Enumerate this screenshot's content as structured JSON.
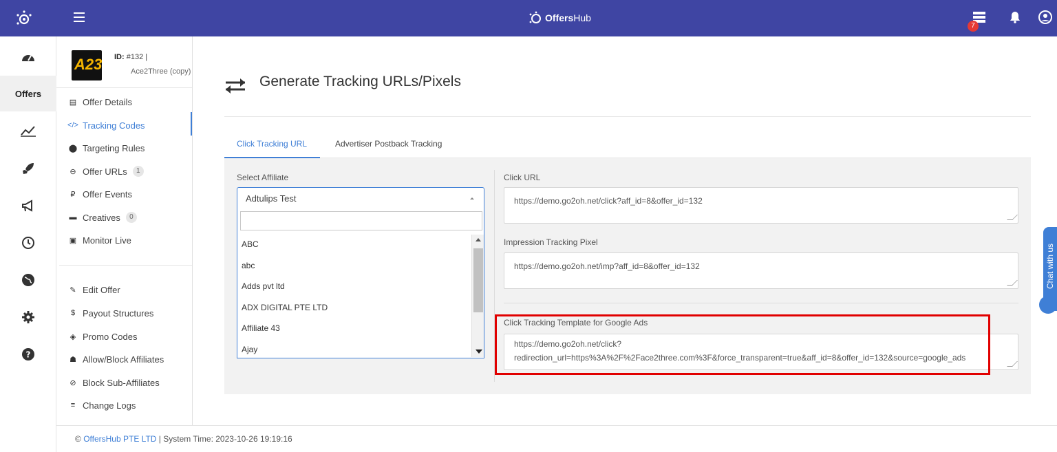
{
  "brand": {
    "name_bold": "Offers",
    "name_rest": "Hub"
  },
  "notifications_count": "7",
  "rail": {
    "active_label": "Offers"
  },
  "offer": {
    "logo_text": "A23",
    "id_label": "ID:",
    "id_value": "#132 |",
    "name": "Ace2Three (copy)"
  },
  "sidebar": {
    "items": [
      {
        "label": "Offer Details",
        "icon": "clipboard-icon"
      },
      {
        "label": "Tracking Codes",
        "icon": "code-icon"
      },
      {
        "label": "Targeting Rules",
        "icon": "map-pin-icon"
      },
      {
        "label": "Offer URLs",
        "icon": "link-icon",
        "count": "1"
      },
      {
        "label": "Offer Events",
        "icon": "events-icon"
      },
      {
        "label": "Creatives",
        "icon": "image-icon",
        "count": "0"
      },
      {
        "label": "Monitor Live",
        "icon": "monitor-icon"
      },
      {
        "label": "Edit Offer",
        "icon": "pencil-icon"
      },
      {
        "label": "Payout Structures",
        "icon": "dollar-icon"
      },
      {
        "label": "Promo Codes",
        "icon": "tag-icon"
      },
      {
        "label": "Allow/Block Affiliates",
        "icon": "users-icon"
      },
      {
        "label": "Block Sub-Affiliates",
        "icon": "block-icon"
      },
      {
        "label": "Change Logs",
        "icon": "list-icon"
      }
    ]
  },
  "page": {
    "title": "Generate Tracking URLs/Pixels",
    "tabs": [
      {
        "label": "Click Tracking URL"
      },
      {
        "label": "Advertiser Postback Tracking"
      }
    ]
  },
  "affiliate": {
    "label": "Select Affiliate",
    "selected": "Adtulips Test",
    "options": [
      "ABC",
      "abc",
      "Adds pvt ltd",
      "ADX DIGITAL PTE LTD",
      "Affiliate 43",
      "Ajay"
    ]
  },
  "fields": {
    "click_url_label": "Click URL",
    "click_url_value": "https://demo.go2oh.net/click?aff_id=8&offer_id=132",
    "impression_label": "Impression Tracking Pixel",
    "impression_value": "https://demo.go2oh.net/imp?aff_id=8&offer_id=132",
    "google_ads_label": "Click Tracking Template for Google Ads",
    "google_ads_value_line1": "https://demo.go2oh.net/click?",
    "google_ads_value_line2": "redirection_url=https%3A%2F%2Face2three.com%3F&force_transparent=true&aff_id=8&offer_id=132&source=google_ads"
  },
  "footer": {
    "copyright": "©",
    "company": "OffersHub PTE LTD",
    "system_time": "| System Time: 2023-10-26 19:19:16"
  },
  "chat": {
    "label": "Chat with us"
  },
  "colors": {
    "topbar": "#3f45a3",
    "accent": "#3f7fd6",
    "highlight": "#e10000"
  }
}
